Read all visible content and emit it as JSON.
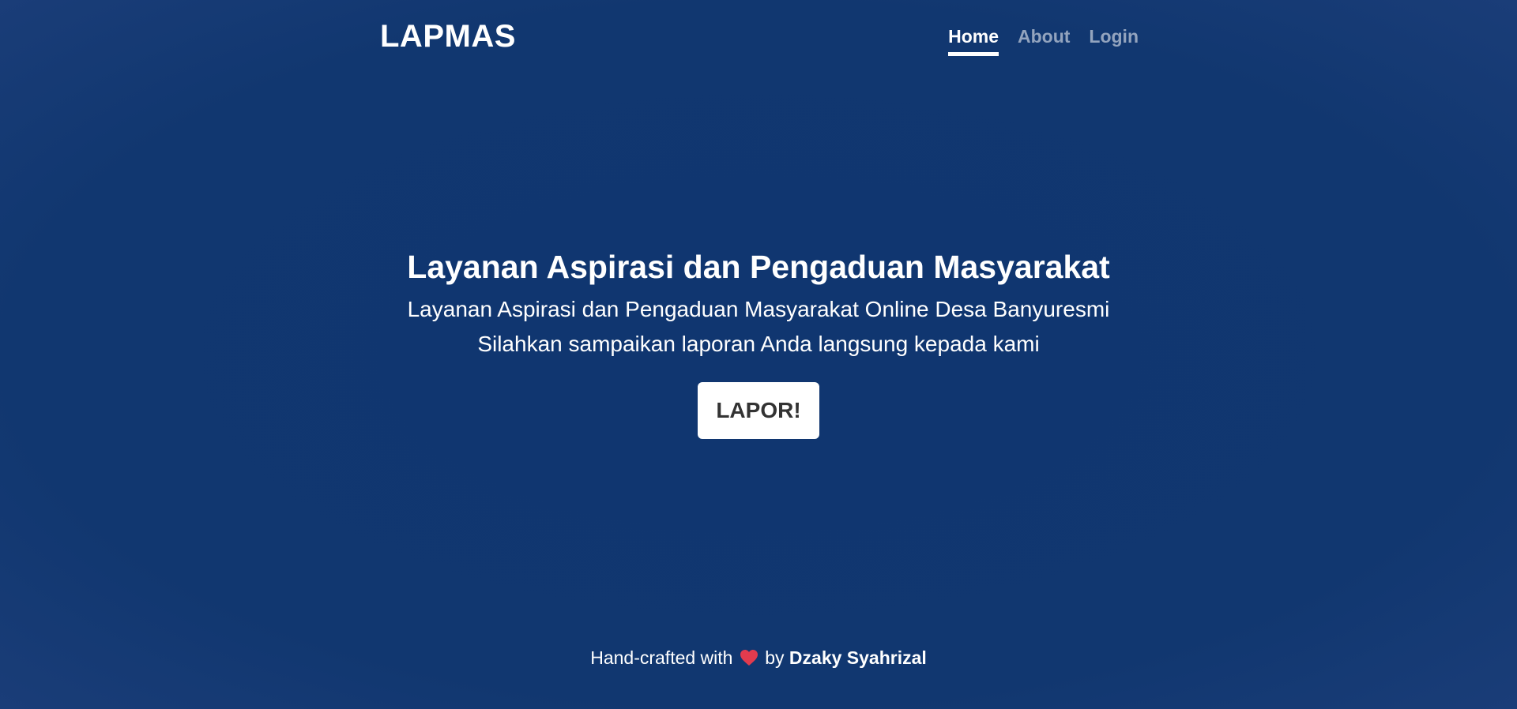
{
  "header": {
    "brand": "LAPMAS",
    "nav": [
      {
        "label": "Home",
        "active": true
      },
      {
        "label": "About",
        "active": false
      },
      {
        "label": "Login",
        "active": false
      }
    ]
  },
  "hero": {
    "title": "Layanan Aspirasi dan Pengaduan Masyarakat",
    "subtitle_line1": "Layanan Aspirasi dan Pengaduan Masyarakat Online Desa Banyuresmi",
    "subtitle_line2": "Silahkan sampaikan laporan Anda langsung kepada kami",
    "cta_label": "LAPOR!"
  },
  "footer": {
    "prefix": "Hand-crafted with",
    "icon": "heart-icon",
    "by": "by",
    "author": "Dzaky Syahrizal"
  },
  "colors": {
    "background": "#113770",
    "heart": "#e23b4e",
    "button_text": "#333333"
  }
}
